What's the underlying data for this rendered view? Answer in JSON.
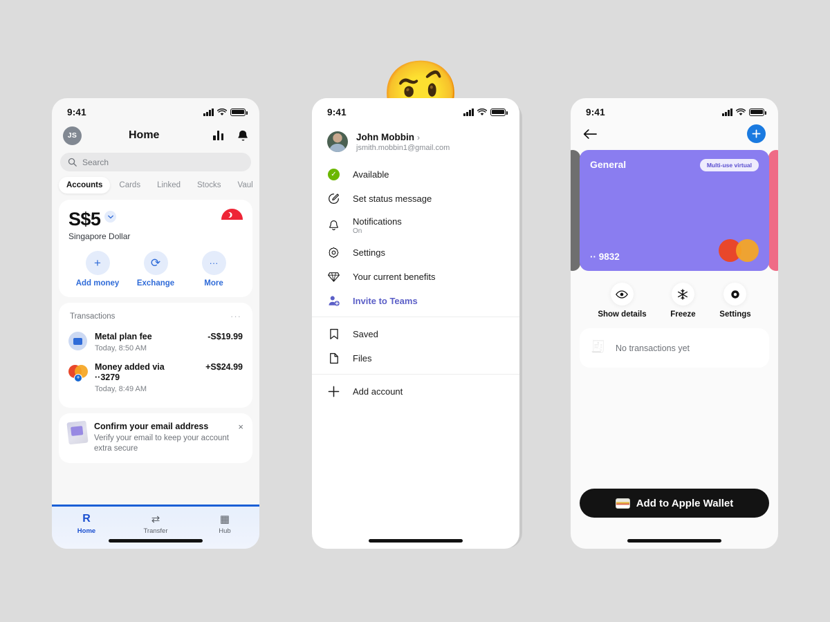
{
  "background_color": "#dcdcdc",
  "phone1": {
    "name": "home-screen",
    "status_bar": {
      "time": "9:41",
      "signal": "signal-icon",
      "wifi": "wifi-icon",
      "battery": "battery-icon"
    },
    "header": {
      "avatar_initials": "JS",
      "title": "Home",
      "chart_icon": "bar-chart-icon",
      "bell_icon": "bell-icon"
    },
    "search": {
      "placeholder": "Search",
      "icon": "search-icon"
    },
    "tabs": [
      {
        "label": "Accounts",
        "active": true
      },
      {
        "label": "Cards",
        "active": false
      },
      {
        "label": "Linked",
        "active": false
      },
      {
        "label": "Stocks",
        "active": false
      },
      {
        "label": "Vaul",
        "active": false
      }
    ],
    "account": {
      "balance": "S$5",
      "currency": "Singapore Dollar",
      "flag": "singapore-flag-icon",
      "chevron": "chevron-down-icon",
      "actions": [
        {
          "glyph": "+",
          "label": "Add money",
          "icon": "plus-icon"
        },
        {
          "glyph": "⟳",
          "label": "Exchange",
          "icon": "exchange-icon"
        },
        {
          "glyph": "···",
          "label": "More",
          "icon": "more-icon"
        }
      ]
    },
    "transactions": {
      "heading": "Transactions",
      "more": "···",
      "items": [
        {
          "title": "Metal plan fee",
          "subtitle": "Today, 8:50 AM",
          "amount": "-S$19.99",
          "icon": "card-icon"
        },
        {
          "title": "Money added via",
          "title2": "··3279",
          "subtitle": "Today, 8:49 AM",
          "amount": "+S$24.99",
          "icon": "mastercard-icon"
        }
      ]
    },
    "promo": {
      "title": "Confirm your email address",
      "subtitle": "Verify your email to keep your account extra secure",
      "close": "×",
      "image": "envelope-icon"
    },
    "tabbar": [
      {
        "label": "Home",
        "glyph": "R",
        "icon": "revolut-logo-icon",
        "active": true
      },
      {
        "label": "Transfer",
        "glyph": "⇄",
        "icon": "transfer-icon",
        "active": false
      },
      {
        "label": "Hub",
        "glyph": "▦",
        "icon": "hub-grid-icon",
        "active": false
      }
    ]
  },
  "behind_panel": {
    "name": "background-screen",
    "people_icon": "add-people-icon"
  },
  "emoji": {
    "name": "raised-eyebrow-face-emoji",
    "glyph": "🤨"
  },
  "phone2": {
    "name": "account-menu-screen",
    "status_bar": {
      "time": "9:41"
    },
    "user": {
      "avatar": "user-avatar",
      "name": "John Mobbin",
      "chevron": "›",
      "email": "jsmith.mobbin1@gmail.com"
    },
    "menu_groups": [
      [
        {
          "label": "Available",
          "icon": "check-circle-icon",
          "kind": "status",
          "highlight": false
        },
        {
          "label": "Set status message",
          "icon": "edit-circle-icon",
          "highlight": false
        },
        {
          "label": "Notifications",
          "sub": "On",
          "icon": "bell-icon",
          "highlight": false
        },
        {
          "label": "Settings",
          "icon": "gear-icon",
          "highlight": false
        },
        {
          "label": "Your current benefits",
          "icon": "diamond-icon",
          "highlight": false
        },
        {
          "label": "Invite to Teams",
          "icon": "person-add-icon",
          "highlight": true
        }
      ],
      [
        {
          "label": "Saved",
          "icon": "bookmark-icon",
          "highlight": false
        },
        {
          "label": "Files",
          "icon": "file-icon",
          "highlight": false
        }
      ],
      [
        {
          "label": "Add account",
          "icon": "plus-icon",
          "highlight": false
        }
      ]
    ],
    "accent_color": "#5b5fc7"
  },
  "phone3": {
    "name": "card-details-screen",
    "status_bar": {
      "time": "9:41"
    },
    "header": {
      "back_icon": "back-arrow-icon",
      "add_icon": "plus-icon"
    },
    "card": {
      "name": "General",
      "badge": "Multi-use virtual",
      "number": "·· 9832",
      "brand_icon": "mastercard-icon",
      "color": "#8a7df0",
      "edge_left_color": "#6f6f6f",
      "edge_right_color": "#ef6b86"
    },
    "actions": [
      {
        "label": "Show details",
        "glyph": "👁",
        "icon": "eye-icon"
      },
      {
        "label": "Freeze",
        "glyph": "❄",
        "icon": "snowflake-icon"
      },
      {
        "label": "Settings",
        "glyph": "⚙",
        "icon": "gear-icon"
      }
    ],
    "empty_state": {
      "text": "No transactions yet",
      "icon": "receipt-icon"
    },
    "wallet_button": {
      "label": "Add to Apple Wallet",
      "icon": "apple-wallet-icon"
    }
  }
}
